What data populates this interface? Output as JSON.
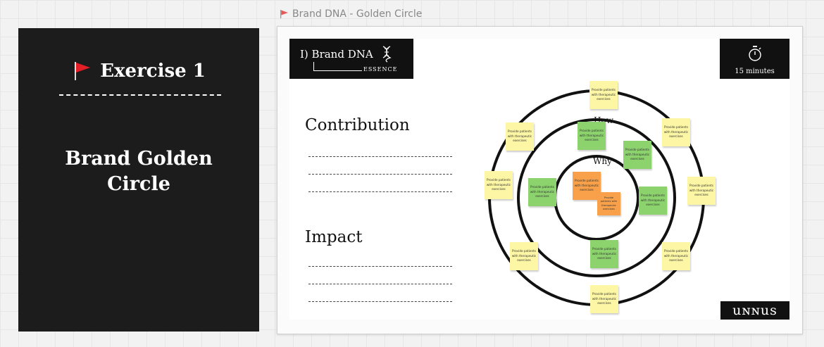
{
  "panel": {
    "exercise_title": "Exercise 1",
    "subtitle": "Brand Golden\nCircle",
    "flag_icon": "red-flag-icon",
    "flag_color": "#e41e26"
  },
  "frame": {
    "label": "Brand DNA - Golden Circle",
    "flag_icon": "red-flag-icon"
  },
  "slide": {
    "brand_title": "I) Brand DNA",
    "brand_sub": "ESSENCE",
    "timer_icon": "stopwatch-icon",
    "timer_text": "15 minutes",
    "headings": {
      "contribution": "Contribution",
      "impact": "Impact"
    },
    "logo": "uɴɴus",
    "circle": {
      "how_label": "How",
      "why_label": "Why",
      "note_text": "Provide patients with therapeutic exercises",
      "colors": {
        "yellow": "#fdf6a4",
        "green": "#8cd36e",
        "orange": "#f8a14a"
      }
    }
  }
}
